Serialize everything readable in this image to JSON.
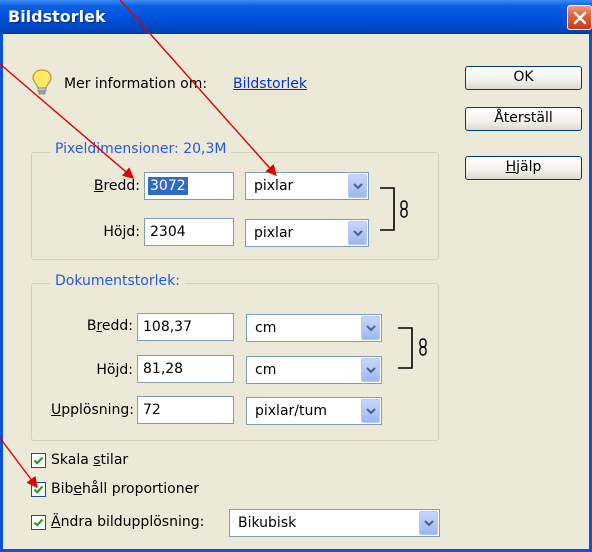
{
  "window": {
    "title": "Bildstorlek",
    "close_icon": "close-icon"
  },
  "info": {
    "label": "Mer information om:",
    "link": "Bildstorlek"
  },
  "buttons": {
    "ok": "OK",
    "reset": "Återställ",
    "help_prefix": "",
    "help_mnemonic": "H",
    "help_rest": "jälp"
  },
  "pixel_dimensions": {
    "legend": "Pixeldimensioner: 20,3M",
    "width": {
      "label_mnemonic": "B",
      "label_rest": "redd:",
      "value": "3072",
      "unit": "pixlar"
    },
    "height": {
      "label_pre": "Hö",
      "label_mnemonic": "j",
      "label_rest": "d:",
      "value": "2304",
      "unit": "pixlar"
    }
  },
  "document_size": {
    "legend": "Dokumentstorlek:",
    "width": {
      "label_pre": "B",
      "label_mnemonic": "r",
      "label_rest": "edd:",
      "value": "108,37",
      "unit": "cm"
    },
    "height": {
      "label_pre": "Hö",
      "label_mnemonic": "j",
      "label_rest": "d:",
      "value": "81,28",
      "unit": "cm"
    },
    "resolution": {
      "label_mnemonic": "U",
      "label_rest": "pplösning:",
      "value": "72",
      "unit": "pixlar/tum"
    }
  },
  "options": {
    "scale_styles": {
      "pre": "Skala ",
      "mnemonic": "s",
      "rest": "tilar",
      "checked": true
    },
    "constrain": {
      "pre": "Bib",
      "mnemonic": "e",
      "rest": "håll proportioner",
      "checked": true
    },
    "resample": {
      "pre": "",
      "mnemonic": "Ä",
      "rest": "ndra bildupplösning:",
      "checked": true,
      "method": "Bikubisk"
    }
  },
  "colors": {
    "titlebar": "#0054e3",
    "legend_text": "#2a59d6",
    "link": "#0033cc",
    "annotation_arrow": "#e00000",
    "selection": "#316ac5"
  }
}
